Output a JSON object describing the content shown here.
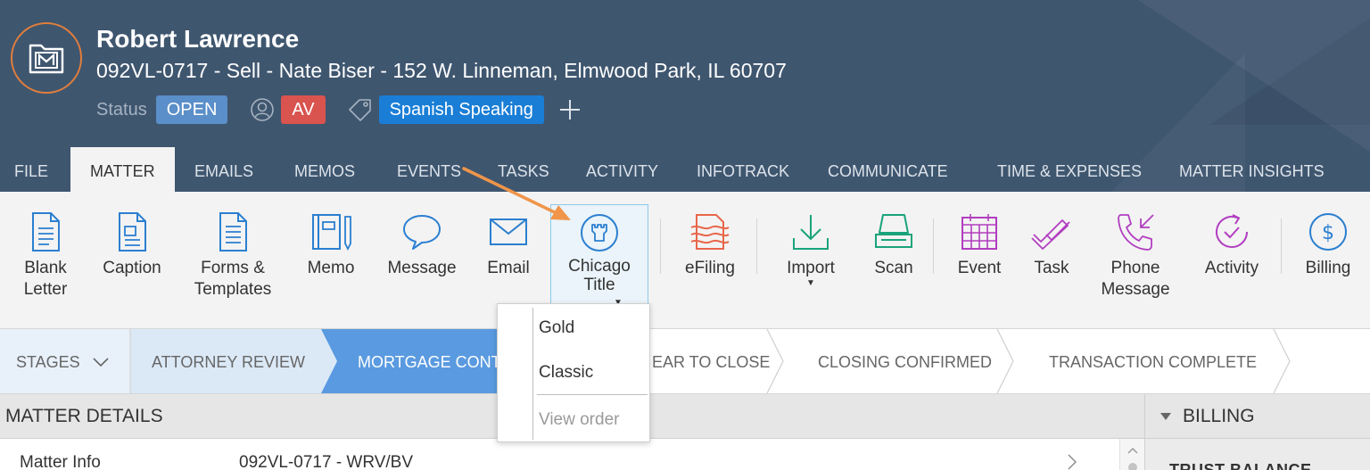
{
  "header": {
    "client_name": "Robert Lawrence",
    "matter_line": "092VL-0717 - Sell - Nate Biser - 152 W. Linneman, Elmwood Park, IL 60707",
    "status_label": "Status",
    "status_value": "OPEN",
    "assignee_initials": "AV",
    "tag": "Spanish Speaking"
  },
  "tabs": [
    {
      "label": "FILE"
    },
    {
      "label": "MATTER",
      "active": true
    },
    {
      "label": "EMAILS"
    },
    {
      "label": "MEMOS"
    },
    {
      "label": "EVENTS"
    },
    {
      "label": "TASKS"
    },
    {
      "label": "ACTIVITY"
    },
    {
      "label": "INFOTRACK"
    },
    {
      "label": "COMMUNICATE"
    },
    {
      "label": "TIME & EXPENSES"
    },
    {
      "label": "MATTER INSIGHTS"
    }
  ],
  "toolbar": {
    "blank_letter": "Blank\nLetter",
    "caption": "Caption",
    "forms_templates": "Forms &\nTemplates",
    "memo": "Memo",
    "message": "Message",
    "email": "Email",
    "chicago_title": "Chicago\nTitle",
    "efiling": "eFiling",
    "import": "Import",
    "scan": "Scan",
    "event": "Event",
    "task": "Task",
    "phone_message": "Phone\nMessage",
    "activity": "Activity",
    "billing": "Billing"
  },
  "stages": {
    "label": "STAGES",
    "items": [
      "ATTORNEY REVIEW",
      "MORTGAGE CONT",
      "EAR TO CLOSE",
      "CLOSING CONFIRMED",
      "TRANSACTION COMPLETE"
    ]
  },
  "dropdown": {
    "items": [
      "Gold",
      "Classic"
    ],
    "disabled_item": "View order"
  },
  "details": {
    "title": "MATTER DETAILS",
    "row_label": "Matter Info",
    "row_value": "092VL-0717 - WRV/BV"
  },
  "billing_panel": {
    "title": "BILLING",
    "subheading": "TRUST BALANCE"
  },
  "colors": {
    "header_bg": "#3f566f",
    "accent_orange": "#e17e3c",
    "status_open": "#5a8fc9",
    "badge_av": "#d9534f",
    "tag_blue": "#1a7ed6",
    "stage_active": "#5a9ae0",
    "stage_done": "#dbe9f7"
  }
}
